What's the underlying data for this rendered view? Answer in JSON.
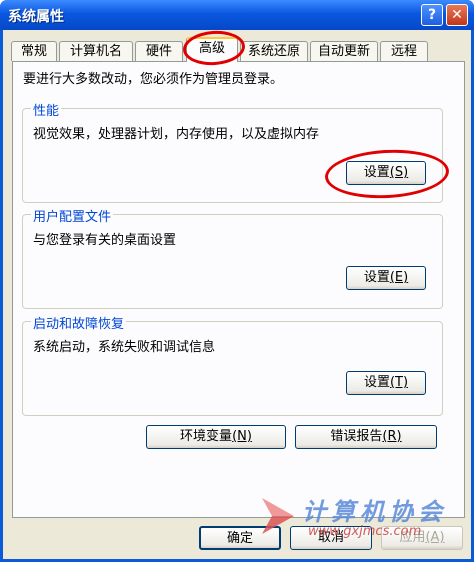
{
  "window": {
    "title": "系统属性",
    "help_button": "?",
    "close_button": "✕"
  },
  "tabs": [
    {
      "label": "常规"
    },
    {
      "label": "计算机名"
    },
    {
      "label": "硬件"
    },
    {
      "label": "高级"
    },
    {
      "label": "系统还原"
    },
    {
      "label": "自动更新"
    },
    {
      "label": "远程"
    }
  ],
  "advanced": {
    "admin_note": "要进行大多数改动，您必须作为管理员登录。",
    "performance": {
      "label": "性能",
      "description": "视觉效果，处理器计划，内存使用，以及虚拟内存",
      "button_text": "设置",
      "button_hotkey": "(S)"
    },
    "user_profiles": {
      "label": "用户配置文件",
      "description": "与您登录有关的桌面设置",
      "button_text": "设置",
      "button_hotkey": "(E)"
    },
    "startup_recovery": {
      "label": "启动和故障恢复",
      "description": "系统启动，系统失败和调试信息",
      "button_text": "设置",
      "button_hotkey": "(T)"
    },
    "env_vars": {
      "text": "环境变量",
      "hotkey": "(N)"
    },
    "error_report": {
      "text": "错误报告",
      "hotkey": "(R)"
    }
  },
  "footer": {
    "ok": "确定",
    "cancel": "取消",
    "apply_text": "应用",
    "apply_hotkey": "(A)"
  },
  "watermark": {
    "text": "计算机协会",
    "url": "www.gxjmcs.com"
  },
  "colors": {
    "title_bar": "#0a58e0",
    "dialog_bg": "#ece9d8",
    "group_label": "#0046d5",
    "highlight_circle": "#e00000"
  }
}
